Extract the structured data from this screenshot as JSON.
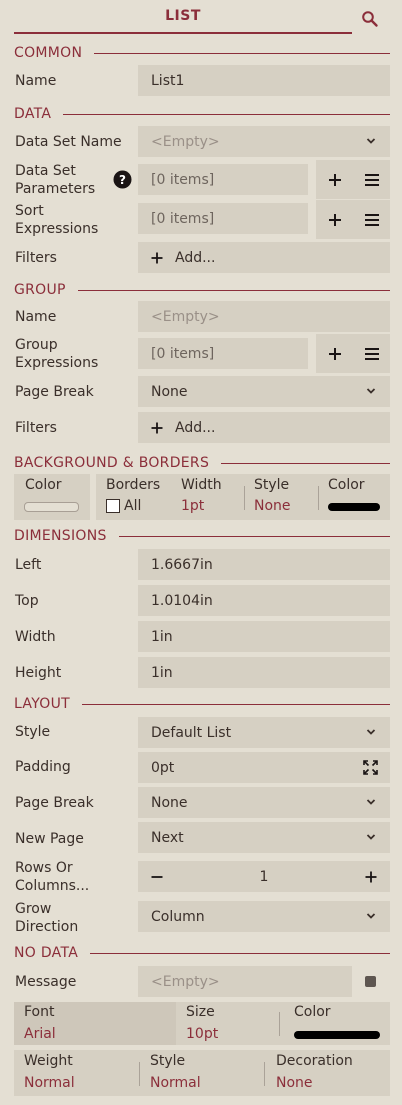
{
  "header": {
    "title": "LIST"
  },
  "sections": {
    "common": "COMMON",
    "data": "DATA",
    "group": "GROUP",
    "bg": "BACKGROUND & BORDERS",
    "dimensions": "DIMENSIONS",
    "layout": "LAYOUT",
    "nodata": "NO DATA"
  },
  "common": {
    "name_label": "Name",
    "name_value": "List1"
  },
  "data": {
    "dataset_label": "Data Set Name",
    "dataset_placeholder": "<Empty>",
    "params_label_1": "Data Set",
    "params_label_2": "Parameters",
    "params_value": "[0 items]",
    "sort_label_1": "Sort",
    "sort_label_2": "Expressions",
    "sort_value": "[0 items]",
    "filters_label": "Filters",
    "filters_add": "Add..."
  },
  "group": {
    "name_label": "Name",
    "name_placeholder": "<Empty>",
    "expr_label_1": "Group",
    "expr_label_2": "Expressions",
    "expr_value": "[0 items]",
    "pagebreak_label": "Page Break",
    "pagebreak_value": "None",
    "filters_label": "Filters",
    "filters_add": "Add..."
  },
  "bg": {
    "color_label": "Color",
    "borders_label": "Borders",
    "all_label": "All",
    "width_label": "Width",
    "width_value": "1pt",
    "style_label": "Style",
    "style_value": "None",
    "bcolor_label": "Color",
    "bg_color": "#e4dfd3",
    "border_color": "#000000"
  },
  "dimensions": {
    "left_label": "Left",
    "left_value": "1.6667in",
    "top_label": "Top",
    "top_value": "1.0104in",
    "width_label": "Width",
    "width_value": "1in",
    "height_label": "Height",
    "height_value": "1in"
  },
  "layout": {
    "style_label": "Style",
    "style_value": "Default List",
    "padding_label": "Padding",
    "padding_value": "0pt",
    "pagebreak_label": "Page Break",
    "pagebreak_value": "None",
    "newpage_label": "New Page",
    "newpage_value": "Next",
    "rows_label_1": "Rows Or",
    "rows_label_2": "Columns...",
    "rows_value": "1",
    "grow_label_1": "Grow",
    "grow_label_2": "Direction",
    "grow_value": "Column"
  },
  "nodata": {
    "message_label": "Message",
    "message_placeholder": "<Empty>",
    "font_label": "Font",
    "font_value": "Arial",
    "size_label": "Size",
    "size_value": "10pt",
    "color_label": "Color",
    "weight_label": "Weight",
    "weight_value": "Normal",
    "style_label": "Style",
    "style_value": "Normal",
    "decoration_label": "Decoration",
    "decoration_value": "None",
    "text_color": "#000000"
  },
  "colors": {
    "accent": "#8b2e3a",
    "panel": "#e4dfd3",
    "field": "#d6d0c3"
  }
}
